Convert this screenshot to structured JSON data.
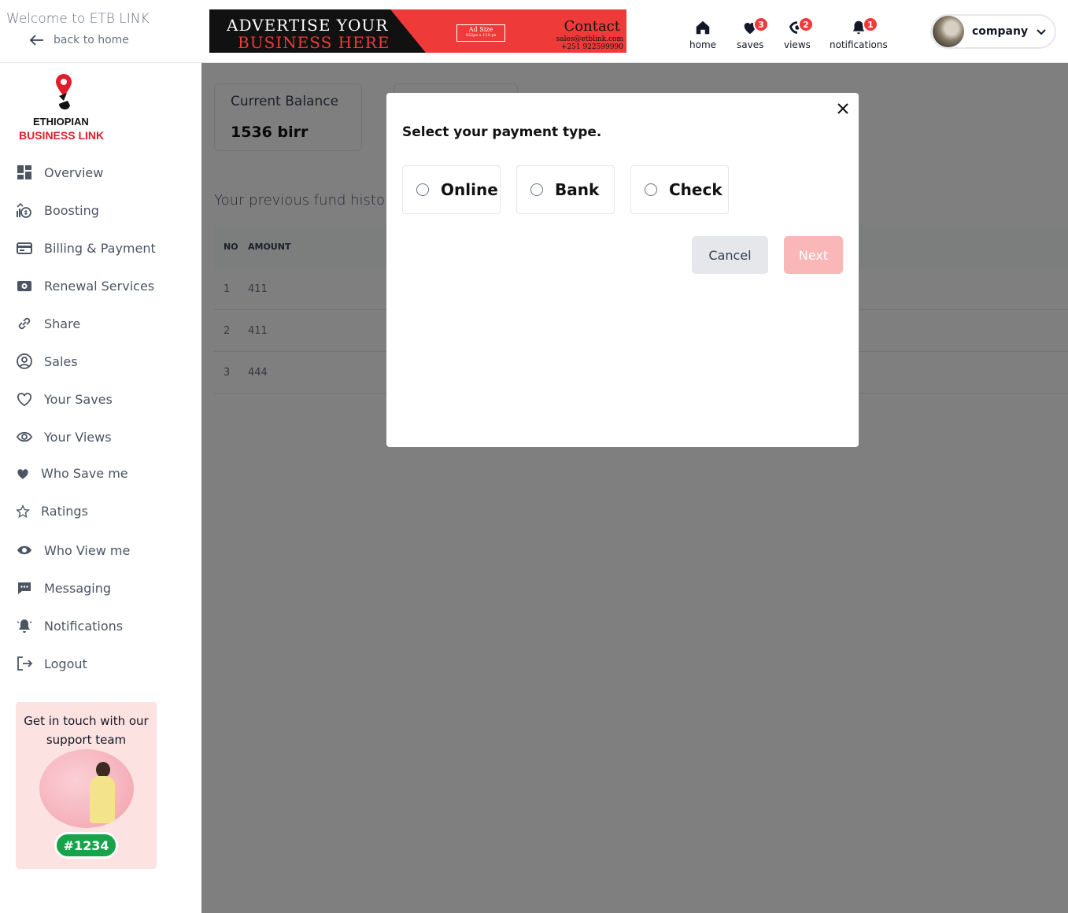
{
  "header": {
    "welcome": "Welcome to ETB LINK",
    "back_label": "back to home",
    "ad": {
      "line1": "ADVERTISE YOUR",
      "line2": "BUSINESS HERE",
      "size_label": "Ad Size",
      "size_dims": "922px x 110 px",
      "contact": "Contact",
      "email": "sales@etblink.com",
      "phone": "+251 922599990"
    },
    "nav": [
      {
        "label": "home",
        "icon": "home-icon"
      },
      {
        "label": "saves",
        "icon": "heart-icon",
        "badge": "3"
      },
      {
        "label": "views",
        "icon": "eye-icon",
        "badge": "2"
      },
      {
        "label": "notifications",
        "icon": "bell-icon",
        "badge": "1"
      }
    ],
    "profile_name": "company"
  },
  "sidebar": {
    "logo_line1": "ETHIOPIAN",
    "logo_line2": "BUSINESS LINK",
    "items": [
      {
        "label": "Overview",
        "icon": "dashboard-icon"
      },
      {
        "label": "Boosting",
        "icon": "money-growth-icon"
      },
      {
        "label": "Billing & Payment",
        "icon": "credit-card-icon"
      },
      {
        "label": "Renewal Services",
        "icon": "cash-icon"
      },
      {
        "label": "Share",
        "icon": "link-icon"
      },
      {
        "label": "Sales",
        "icon": "user-circle-icon"
      },
      {
        "label": "Your Saves",
        "icon": "heart-outline-icon"
      },
      {
        "label": "Your Views",
        "icon": "eye-outline-icon"
      },
      {
        "label": "Who Save me",
        "icon": "heart-filled-icon"
      },
      {
        "label": "Ratings",
        "icon": "star-icon"
      },
      {
        "label": "Who View me",
        "icon": "eye-filled-icon"
      },
      {
        "label": "Messaging",
        "icon": "chat-icon"
      },
      {
        "label": "Notifications",
        "icon": "bell-ring-icon"
      },
      {
        "label": "Logout",
        "icon": "logout-icon"
      }
    ],
    "support": {
      "title": "Get in touch with our support team",
      "phone": "#1234"
    }
  },
  "main": {
    "balance_label": "Current Balance",
    "balance_value": "1536 birr",
    "history_title": "Your previous fund history",
    "table": {
      "headers": [
        "NO",
        "AMOUNT"
      ],
      "rows": [
        [
          "1",
          "411"
        ],
        [
          "2",
          "411"
        ],
        [
          "3",
          "444"
        ]
      ]
    }
  },
  "modal": {
    "title": "Select your payment type.",
    "options": [
      "Online",
      "Bank",
      "Check"
    ],
    "cancel_label": "Cancel",
    "next_label": "Next"
  },
  "colors": {
    "brand_red": "#ef3a3a",
    "overlay": "rgba(0,0,0,0.5)",
    "next_disabled": "#fab7b7",
    "support_bg": "#fde2e2",
    "support_phone": "#16a34a"
  }
}
